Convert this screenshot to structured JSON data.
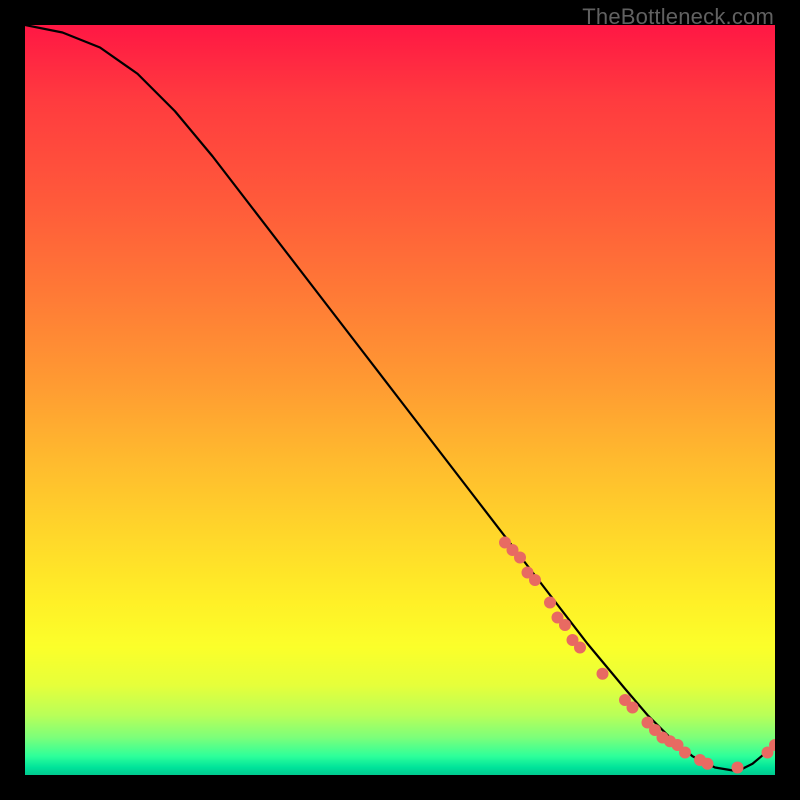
{
  "watermark": "TheBottleneck.com",
  "colors": {
    "black": "#000000",
    "marker": "#e86a62",
    "curve": "#000000",
    "gradient_stops": [
      "#ff1744",
      "#ff3b3f",
      "#ff5b3a",
      "#ff7a36",
      "#ff9b32",
      "#ffba2e",
      "#ffd72a",
      "#fff027",
      "#fbff2a",
      "#e6ff3a",
      "#b9ff58",
      "#7cff7a",
      "#2dff9a",
      "#00e39a",
      "#00c98f"
    ]
  },
  "chart_data": {
    "type": "line",
    "title": "",
    "xlabel": "",
    "ylabel": "",
    "xlim": [
      0,
      100
    ],
    "ylim": [
      0,
      100
    ],
    "curve": {
      "x": [
        0,
        5,
        10,
        15,
        20,
        25,
        30,
        35,
        40,
        45,
        50,
        55,
        60,
        65,
        70,
        75,
        80,
        83,
        86,
        89,
        92,
        95,
        97,
        100
      ],
      "y": [
        100,
        99,
        97,
        93.5,
        88.5,
        82.5,
        76,
        69.5,
        63,
        56.5,
        50,
        43.5,
        37,
        30.5,
        24,
        17.5,
        11.5,
        8,
        5,
        2.5,
        1,
        0.5,
        1.5,
        4
      ]
    },
    "markers": [
      {
        "x": 64,
        "y": 31
      },
      {
        "x": 65,
        "y": 30
      },
      {
        "x": 66,
        "y": 29
      },
      {
        "x": 67,
        "y": 27
      },
      {
        "x": 68,
        "y": 26
      },
      {
        "x": 70,
        "y": 23
      },
      {
        "x": 71,
        "y": 21
      },
      {
        "x": 72,
        "y": 20
      },
      {
        "x": 73,
        "y": 18
      },
      {
        "x": 74,
        "y": 17
      },
      {
        "x": 77,
        "y": 13.5
      },
      {
        "x": 80,
        "y": 10
      },
      {
        "x": 81,
        "y": 9
      },
      {
        "x": 83,
        "y": 7
      },
      {
        "x": 84,
        "y": 6
      },
      {
        "x": 85,
        "y": 5
      },
      {
        "x": 86,
        "y": 4.5
      },
      {
        "x": 87,
        "y": 4
      },
      {
        "x": 88,
        "y": 3
      },
      {
        "x": 90,
        "y": 2
      },
      {
        "x": 91,
        "y": 1.5
      },
      {
        "x": 95,
        "y": 1
      },
      {
        "x": 99,
        "y": 3
      },
      {
        "x": 100,
        "y": 4
      }
    ]
  }
}
